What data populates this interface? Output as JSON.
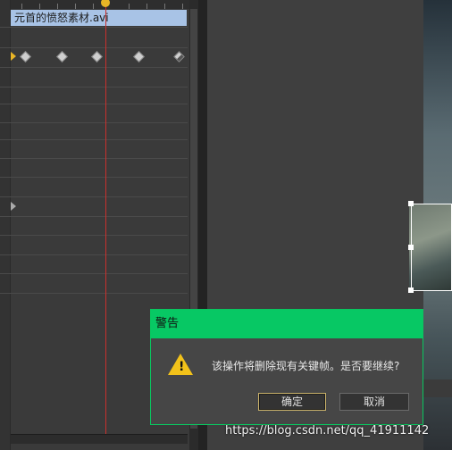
{
  "timeline": {
    "clip_name": "元首的愤怒素材.avi"
  },
  "dialog": {
    "title": "警告",
    "message": "该操作将删除现有关键帧。是否要继续?",
    "ok_label": "确定",
    "cancel_label": "取消",
    "icon": "warning-icon"
  },
  "watermark": "https://blog.csdn.net/qq_41911142",
  "colors": {
    "dialog_title_bg": "#07c864",
    "clip_bg": "#a8c3e6",
    "playhead": "#c9302c",
    "keyframe_selected": "#e9b526"
  }
}
